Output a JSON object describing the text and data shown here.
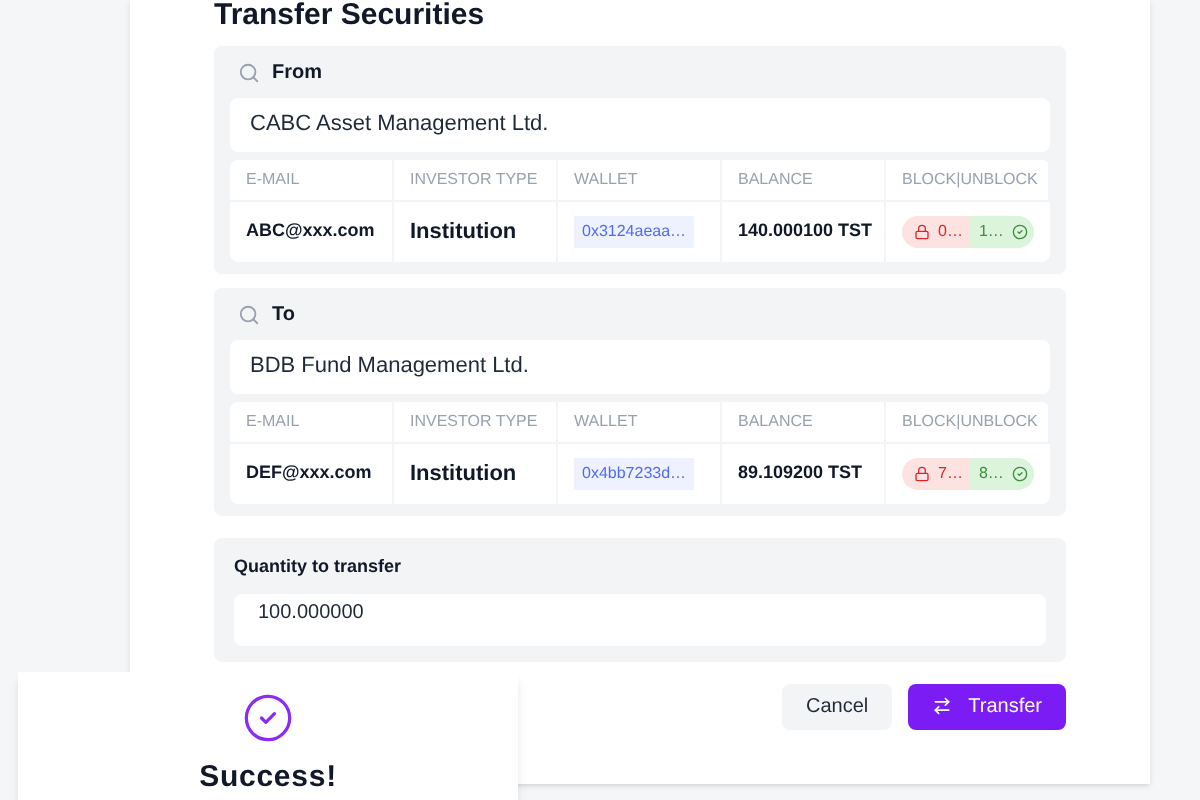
{
  "title": "Transfer Securities",
  "parties": [
    {
      "label": "From",
      "name": "CABC Asset Management Ltd.",
      "columns": [
        "E-MAIL",
        "INVESTOR TYPE",
        "WALLET",
        "BALANCE",
        "BLOCK|UNBLOCK"
      ],
      "email": "ABC@xxx.com",
      "investor_type": "Institution",
      "wallet": "0x3124aeaa…",
      "balance": "140.000100 TST",
      "blocked": "0…",
      "unblocked": "1…"
    },
    {
      "label": "To",
      "name": "BDB Fund Management Ltd.",
      "columns": [
        "E-MAIL",
        "INVESTOR TYPE",
        "WALLET",
        "BALANCE",
        "BLOCK|UNBLOCK"
      ],
      "email": "DEF@xxx.com",
      "investor_type": "Institution",
      "wallet": "0x4bb7233d…",
      "balance": "89.109200 TST",
      "blocked": "7…",
      "unblocked": "8…"
    }
  ],
  "quantity": {
    "label": "Quantity to transfer",
    "value": "100.000000"
  },
  "buttons": {
    "cancel": "Cancel",
    "transfer": "Transfer"
  },
  "toast": {
    "title": "Success!"
  }
}
